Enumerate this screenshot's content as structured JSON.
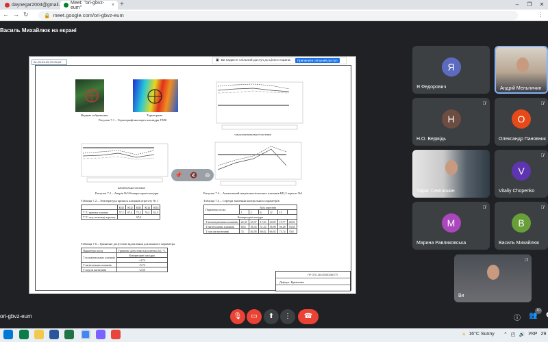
{
  "browser": {
    "tabs": [
      {
        "label": "daynegar2004@gmail...",
        "active": false
      },
      {
        "label": "Meet: \"ori-gbvz-eum\"",
        "active": true
      }
    ],
    "new_tab": "+",
    "url": "meet.google.com/ori-gbvz-eum",
    "window_controls": [
      "–",
      "❐",
      "✕"
    ]
  },
  "meet": {
    "presenting_label": "Василь Михайлюк на екрані",
    "meeting_code": "ori-gbvz-eum",
    "share_banner": "Ви надаєте спільний доступ до цілого екрана.",
    "share_stop_button": "Припинити спільний доступ",
    "controls": {
      "mic": "mic-off",
      "camera": "camera-off",
      "present": "present",
      "more": "more",
      "hangup": "hangup"
    },
    "people_count": "10"
  },
  "slide": {
    "pdf_header": "А1-00-03-29-70-09.pdf",
    "figures": {
      "fig71_sub_a": "Видиме зображення",
      "fig71_sub_b": "Термограма",
      "fig71": "Рисунок 7.1 – Термографічна карта шахвідри ГМК",
      "fig72": "Рисунок 7.2 – Аварія №5 Компресорні шахідри",
      "fig72_xlabel": "нагнітальна частина",
      "fig73_xlabel": "з відсмоктувальної частини",
      "fig74": "Рисунок 7.4 – Аномальний нагрів нагнітальних клапанів КЦ 5 агрегат №1"
    },
    "table72": {
      "title": "Таблиця 7.2 – Температура кришок клапанів агрегату № 1",
      "header": [
        "",
        "КЦ1",
        "КЦ2",
        "КЦ3",
        "КЦ4",
        "КЦ5"
      ],
      "rows": [
        [
          "Т °С кришки клапану",
          "57,2",
          "67,4",
          "75,2",
          "76,4",
          "61,3"
        ],
        [
          "Т °С газу на виході агрегату",
          "",
          "",
          "67,0",
          "",
          ""
        ]
      ]
    },
    "table74": {
      "title": "Таблиця 7.4 – Середні значення контрольних параметрів",
      "col_group": "№№ агрегатів",
      "header": [
        "Параметри пуску",
        "1",
        "2",
        "6",
        "12",
        "13"
      ],
      "subheader": "Компресорні шахідри",
      "rows": [
        [
          "Т всмоктувальних клапанів",
          "22,35",
          "25,37",
          "17,63",
          "20,95",
          "19,77",
          "20,81"
        ],
        [
          "Т нагнітальних клапанів",
          "60,6",
          "56,35",
          "51,24",
          "56,96",
          "56,28",
          "53,63"
        ],
        [
          "Т газу на нагнітанні",
          "74",
          "84,58",
          "60,02",
          "66,92",
          "75,74",
          "70,8"
        ]
      ]
    },
    "table76": {
      "title": "Таблиця 7.6 – Гранично допустимі відхилення для кожного параметра",
      "header": [
        "Параметри пуску",
        "Гранично допустимі відхилення (2σ), °С"
      ],
      "subheader": "Компресорні шахідри",
      "rows": [
        [
          "Т всмоктувальних клапанів",
          "<4,74"
        ],
        [
          "Т нагнітальних клапанів",
          "<5,74"
        ],
        [
          "Т газу на нагнітанні",
          "<2,50"
        ]
      ]
    },
    "stamp_code": "ПР 370-28-00280280 ГЛ",
    "stamp_name": "Дефчук. Кравченко"
  },
  "participants": [
    {
      "name": "Я Федорович",
      "initial": "Я",
      "color": "#5c6bc0",
      "muted": false,
      "video": false
    },
    {
      "name": "Андрій Мельничин",
      "initial": "",
      "color": "",
      "muted": false,
      "video": true
    },
    {
      "name": "Н.О. Ведмідь",
      "initial": "Н",
      "color": "#6d4c41",
      "muted": true,
      "video": false
    },
    {
      "name": "Олександр Пановник",
      "initial": "О",
      "color": "#e64a19",
      "muted": true,
      "video": false
    },
    {
      "name": "Тарас Семчишин",
      "initial": "",
      "color": "",
      "muted": false,
      "video": true
    },
    {
      "name": "Vitaliy Chopenko",
      "initial": "V",
      "color": "#5e35b1",
      "muted": true,
      "video": false
    },
    {
      "name": "Марина Равликовська",
      "initial": "М",
      "color": "#ab47bc",
      "muted": true,
      "video": false
    },
    {
      "name": "Василь Михайлюк",
      "initial": "В",
      "color": "#689f38",
      "muted": true,
      "video": false
    },
    {
      "name": "Ви",
      "initial": "",
      "color": "",
      "muted": true,
      "video": true
    }
  ],
  "taskbar": {
    "weather": "16°C  Sunny",
    "tray_lang": "УКР",
    "clock": "29"
  }
}
